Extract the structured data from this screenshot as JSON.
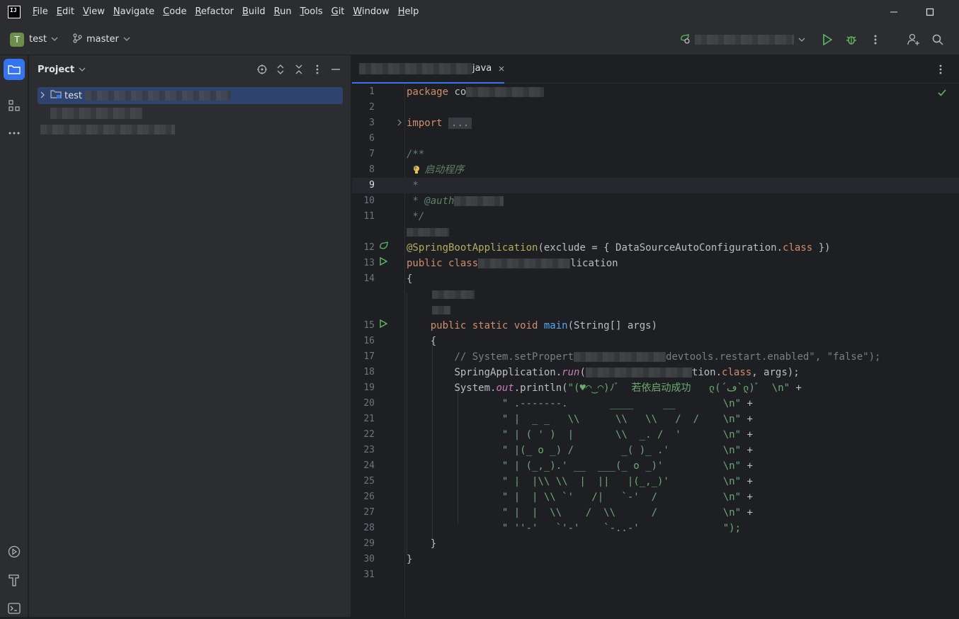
{
  "menu": {
    "items": [
      {
        "u": "F",
        "rest": "ile"
      },
      {
        "u": "E",
        "rest": "dit"
      },
      {
        "u": "V",
        "rest": "iew"
      },
      {
        "u": "N",
        "rest": "avigate"
      },
      {
        "u": "C",
        "rest": "ode"
      },
      {
        "u": "R",
        "rest": "efactor"
      },
      {
        "u": "B",
        "rest": "uild"
      },
      {
        "u": "R",
        "rest": "un"
      },
      {
        "u": "T",
        "rest": "ools"
      },
      {
        "u": "G",
        "rest": "it"
      },
      {
        "u": "W",
        "rest": "indow"
      },
      {
        "u": "H",
        "rest": "elp"
      }
    ]
  },
  "toolbar": {
    "project_badge": "T",
    "project_name": "test",
    "branch": "master"
  },
  "project_panel": {
    "title": "Project",
    "root_label": "test"
  },
  "editor": {
    "tab_suffix": "java",
    "lines": {
      "l1_kw": "package",
      "l1_rest": " co",
      "l3_kw": "import",
      "l3_fold": "...",
      "l7": "/**",
      "l8": " * 启动程序",
      "l9": " *",
      "l10": " * @auth",
      "l11": " */",
      "l12_ann": "@SpringBootApplication",
      "l12_rest": "(exclude = { DataSourceAutoConfiguration.",
      "l12_kw": "class",
      "l12_end": " })",
      "l13_kw": "public class",
      "l13_rest": "lication",
      "l14": "{",
      "l15_kw": "public static void",
      "l15_fn": "main",
      "l15_rest": "(String[] args)",
      "l16": "{",
      "l17": "// System.setPropert",
      "l17_b": "devtools.restart.enabled\", \"false\");",
      "l18_a": "SpringApplication.",
      "l18_run": "run",
      "l18_b": "(",
      "l18_c": "tion.",
      "l18_kw": "class",
      "l18_d": ", args);",
      "l19_a": "System.",
      "l19_out": "out",
      "l19_b": ".println(",
      "l19_str": "\"(♥◠‿◠)ﾉﾞ  若依启动成功   ლ(´ڡ`ლ)ﾞ  \\n\"",
      "l19_plus": " +",
      "l20": "\" .-------.       ____     __        \\n\"",
      "l21": "\" |  _ _   \\\\      \\\\   \\\\   /  /    \\n\"",
      "l22": "\" | ( ' )  |       \\\\  _. /  '       \\n\"",
      "l23": "\" |(_ o _) /        _( )_ .'         \\n\"",
      "l24": "\" | (_,_).' __  ___(_ o _)'          \\n\"",
      "l25": "\" |  |\\\\ \\\\  |  ||   |(_,_)'         \\n\"",
      "l26": "\" |  | \\\\ `'   /|   `-'  /           \\n\"",
      "l27": "\" |  |  \\\\    /  \\\\      /           \\n\"",
      "l28": "\" ''-'   `'-'    `-..-'              \");",
      "l29": "}",
      "l30": "}"
    },
    "line_numbers": [
      "1",
      "2",
      "3",
      "6",
      "7",
      "8",
      "9",
      "10",
      "11",
      "12",
      "13",
      "14",
      "15",
      "16",
      "17",
      "18",
      "19",
      "20",
      "21",
      "22",
      "23",
      "24",
      "25",
      "26",
      "27",
      "28",
      "29",
      "30",
      "31"
    ]
  },
  "colors": {
    "accent": "#3574f0",
    "run_green": "#5fb865",
    "check_green": "#5fb865"
  }
}
